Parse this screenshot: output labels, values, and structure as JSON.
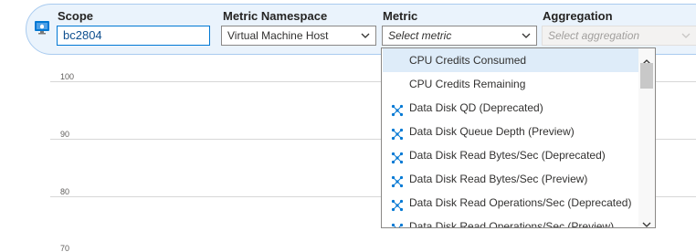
{
  "toolbar": {
    "scope": {
      "label": "Scope",
      "value": "bc2804"
    },
    "namespace": {
      "label": "Metric Namespace",
      "value": "Virtual Machine Host"
    },
    "metric": {
      "label": "Metric",
      "placeholder": "Select metric"
    },
    "aggregation": {
      "label": "Aggregation",
      "placeholder": "Select aggregation"
    }
  },
  "chart": {
    "y_ticks": [
      "100",
      "90",
      "80",
      "70"
    ]
  },
  "metric_options": [
    {
      "label": "CPU Credits Consumed",
      "icon": "none",
      "selected": true
    },
    {
      "label": "CPU Credits Remaining",
      "icon": "none",
      "selected": false
    },
    {
      "label": "Data Disk QD (Deprecated)",
      "icon": "deprecated-metric-icon",
      "selected": false
    },
    {
      "label": "Data Disk Queue Depth (Preview)",
      "icon": "preview-metric-icon",
      "selected": false
    },
    {
      "label": "Data Disk Read Bytes/Sec (Deprecated)",
      "icon": "deprecated-metric-icon",
      "selected": false
    },
    {
      "label": "Data Disk Read Bytes/Sec (Preview)",
      "icon": "preview-metric-icon",
      "selected": false
    },
    {
      "label": "Data Disk Read Operations/Sec (Deprecated)",
      "icon": "deprecated-metric-icon",
      "selected": false
    },
    {
      "label": "Data Disk Read Operations/Sec (Preview)",
      "icon": "preview-metric-icon",
      "selected": false
    }
  ],
  "colors": {
    "accent": "#0078d4",
    "toolbar_bg": "#eaf3fc",
    "selected_row": "#deecf9"
  }
}
